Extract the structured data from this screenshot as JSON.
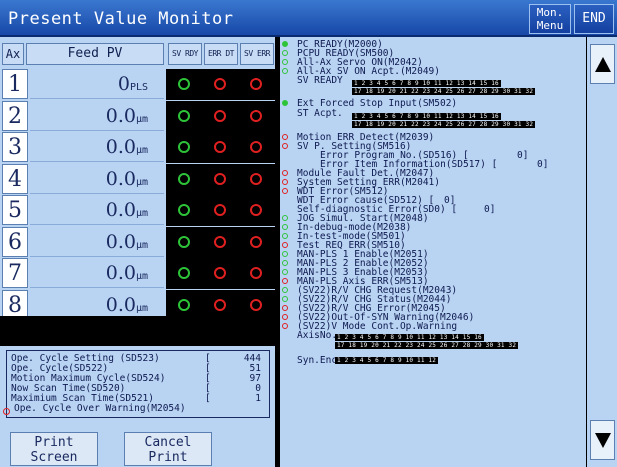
{
  "title": "Present Value Monitor",
  "menu_button": [
    "Mon.",
    "Menu"
  ],
  "end_button": "END",
  "table": {
    "col_ax": "Ax",
    "col_pv": "Feed PV",
    "col_svr": "SV RDY",
    "col_err": "ERR DT",
    "col_sve": "SV ERR",
    "rows": [
      {
        "ax": "1",
        "value": "0",
        "unit": "PLS"
      },
      {
        "ax": "2",
        "value": "0.0",
        "unit": "μm"
      },
      {
        "ax": "3",
        "value": "0.0",
        "unit": "μm"
      },
      {
        "ax": "4",
        "value": "0.0",
        "unit": "μm"
      },
      {
        "ax": "5",
        "value": "0.0",
        "unit": "μm"
      },
      {
        "ax": "6",
        "value": "0.0",
        "unit": "μm"
      },
      {
        "ax": "7",
        "value": "0.0",
        "unit": "μm"
      },
      {
        "ax": "8",
        "value": "0.0",
        "unit": "μm"
      }
    ]
  },
  "cycle": {
    "rows": [
      {
        "label": "Ope. Cycle Setting (SD523)",
        "value": "444"
      },
      {
        "label": "Ope. Cycle(SD522)",
        "value": "51"
      },
      {
        "label": "Motion Maximum Cycle(SD524)",
        "value": "97"
      },
      {
        "label": "Now Scan Time(SD520)",
        "value": "0"
      },
      {
        "label": "Maximium Scan Time(SD521)",
        "value": "1"
      }
    ],
    "warning": "Ope. Cycle Over Warning(M2054)"
  },
  "print_button": [
    "Print",
    "Screen"
  ],
  "cancel_button": [
    "Cancel",
    "Print"
  ],
  "status": {
    "pc_ready": "PC READY(M2000)",
    "pcpu_ready": "PCPU READY(SM500)",
    "all_servo_on": "All-Ax Servo ON(M2042)",
    "all_sv_on_acpt": "All-Ax SV ON Acpt.(M2049)",
    "sv_ready": "SV READY",
    "ext_forced_stop": "Ext Forced Stop Input(SM502)",
    "st_acpt": "ST Acpt.",
    "motion_err": "Motion ERR Detect(M2039)",
    "sv_p_setting": "SV P. Setting(SM516)",
    "error_program": "Error Program No.(SD516) [",
    "error_program_val": "0]",
    "error_item": "Error Item Information(SD517) [",
    "error_item_val": "0]",
    "module_fault": "Module Fault Det.(M2047)",
    "system_setting_err": "System Setting ERR(M2041)",
    "wdt_error": "WDT Error(SM512)",
    "wdt_cause": "WDT Error cause(SD512) [",
    "wdt_cause_val": "0]",
    "self_diag": "Self-diagnostic Error(SD0) [",
    "self_diag_val": "0]",
    "jog_simul": "JOG Simul. Start(M2048)",
    "in_debug": "In-debug-mode(M2038)",
    "in_test": "In-test-mode(SM501)",
    "test_req_err": "Test REQ ERR(SM510)",
    "man_pls1": "MAN-PLS 1 Enable(M2051)",
    "man_pls2": "MAN-PLS 2 Enable(M2052)",
    "man_pls3": "MAN-PLS 3 Enable(M2053)",
    "man_pls_axis_err": "MAN-PLS Axis ERR(SM513)",
    "rv_chg_req": "(SV22)R/V CHG Request(M2043)",
    "rv_chg_status": "(SV22)R/V CHG Status(M2044)",
    "rv_chg_error": "(SV22)R/V CHG Error(M2045)",
    "out_of_syn": "(SV22)Out-Of-SYN Warning(M2046)",
    "v_mode_cont": "(SV22)V Mode Cont.Op.Warning",
    "axis_no": "AxisNo.",
    "syn_enc": "Syn.Enc",
    "bits_row1": "1 2 3 4 5 6 7 8 9 10 11 12 13 14 15 16",
    "bits_row2": "17 18 19 20 21 22 23 24 25 26 27 28 29 30 31 32",
    "bits_syn": "1 2 3 4 5 6 7 8 9 10 11 12"
  },
  "colors": {
    "green_lamp": "#2ec43a",
    "red_lamp": "#e02020",
    "panel": "#b9d3f2",
    "title_bar": "#1848a8"
  }
}
